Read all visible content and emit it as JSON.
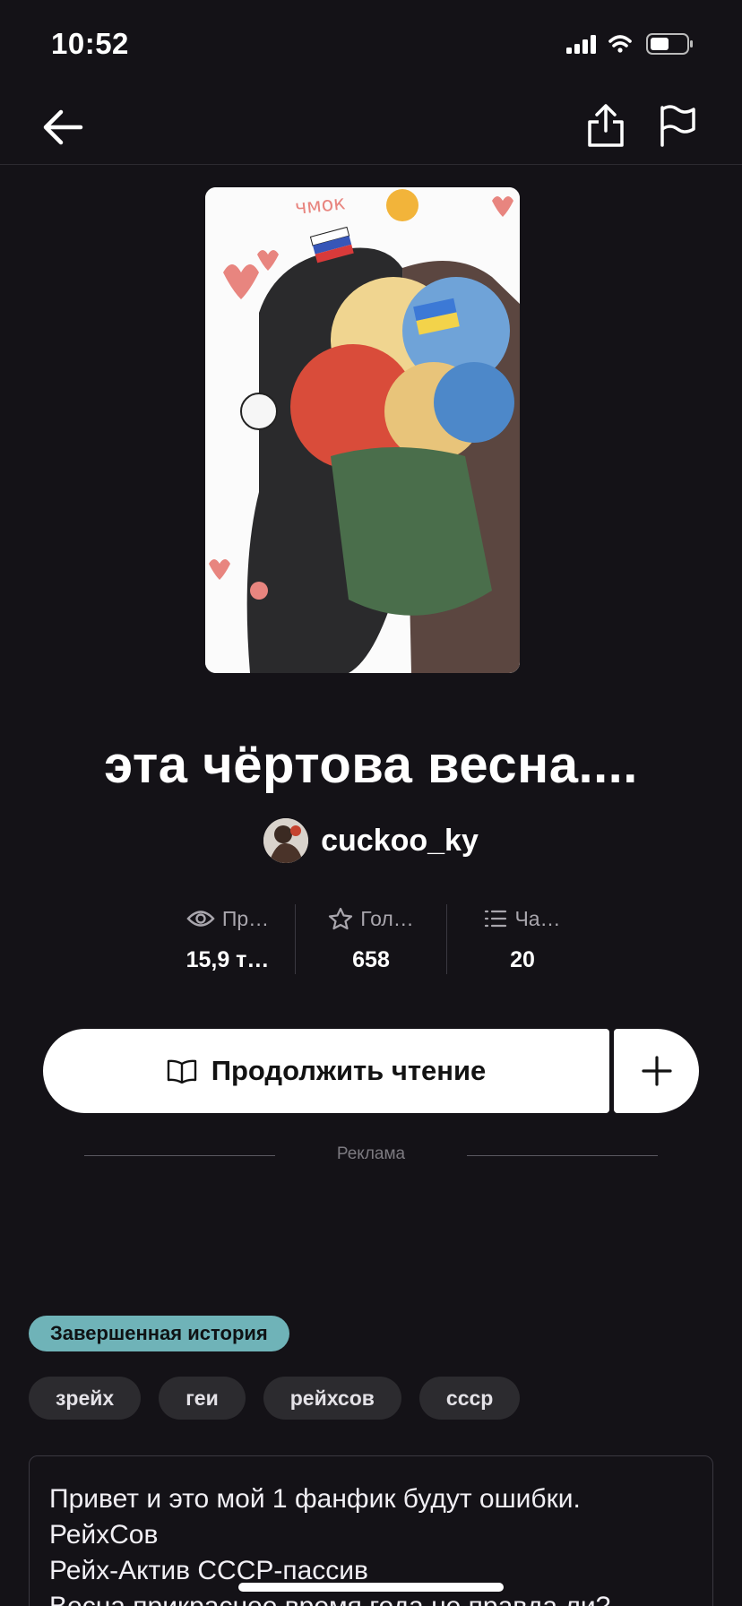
{
  "status_bar": {
    "time": "10:52"
  },
  "story": {
    "title": "эта чёртова весна....",
    "author": "cuckoo_ky"
  },
  "stats": [
    {
      "icon": "eye-icon",
      "label": "Пр…",
      "value": "15,9 т…"
    },
    {
      "icon": "star-icon",
      "label": "Гол…",
      "value": "658"
    },
    {
      "icon": "list-icon",
      "label": "Ча…",
      "value": "20"
    }
  ],
  "actions": {
    "continue_label": "Продолжить чтение"
  },
  "ad": {
    "label": "Реклама"
  },
  "completion_badge": "Завершенная история",
  "tags": [
    "зрейх",
    "геи",
    "рейхсов",
    "ссср"
  ],
  "description": [
    "Привет и это мой 1 фанфик будут ошибки.",
    "РейхСов",
    "Рейх-Актив СССР-пассив",
    "Весна прикрасное время года не правда ли?"
  ],
  "colors": {
    "background": "#141217",
    "badge": "#6fb3b8",
    "tag_bg": "#2c2b2f"
  }
}
